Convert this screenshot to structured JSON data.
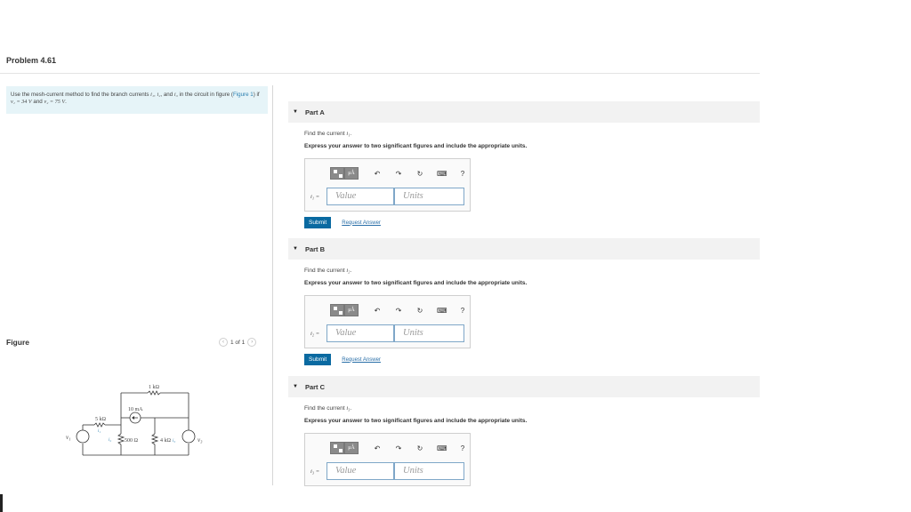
{
  "title": "Problem 4.61",
  "intro": {
    "text_a": "Use the mesh-current method to find the branch currents ",
    "i1": "i₁",
    "sep1": ", ",
    "i2": "i₂",
    "text_b": ", and ",
    "i3": "i₃",
    "text_c": " in the circuit in figure (",
    "figure_link": "Figure 1",
    "text_d": ") if ",
    "v1": "v₁ = 34 V",
    "text_e": " and ",
    "v2": "v₂ = 75 V",
    "text_f": "."
  },
  "figure": {
    "label": "Figure",
    "pager_text": "1 of 1",
    "prev_icon": "chevron-left-icon",
    "next_icon": "chevron-right-icon",
    "labels": {
      "r_top": "1 kΩ",
      "src_current": "10 mA",
      "r_left": "5 kΩ",
      "r_mid": "500 Ω",
      "r_right": "4 kΩ",
      "v1": "v₁",
      "v3": "v₃",
      "i1": "i₁",
      "i2": "i₂",
      "i3": "i₃"
    }
  },
  "parts": [
    {
      "name": "Part A",
      "find_text": "Find the current ",
      "find_var": "i₁",
      "find_end": ".",
      "express": "Express your answer to two significant figures and include the appropriate units.",
      "var_label": "i₁ =",
      "value_placeholder": "Value",
      "units_placeholder": "Units",
      "submit": "Submit",
      "request": "Request Answer"
    },
    {
      "name": "Part B",
      "find_text": "Find the current ",
      "find_var": "i₂",
      "find_end": ".",
      "express": "Express your answer to two significant figures and include the appropriate units.",
      "var_label": "i₂ =",
      "value_placeholder": "Value",
      "units_placeholder": "Units",
      "submit": "Submit",
      "request": "Request Answer"
    },
    {
      "name": "Part C",
      "find_text": "Find the current ",
      "find_var": "i₃",
      "find_end": ".",
      "express": "Express your answer to two significant figures and include the appropriate units.",
      "var_label": "i₃ =",
      "value_placeholder": "Value",
      "units_placeholder": "Units"
    }
  ],
  "toolbar": {
    "template_icon": "templates-icon",
    "mu_label": "μÅ",
    "undo_icon": "undo-icon",
    "redo_icon": "redo-icon",
    "reset_icon": "reset-icon",
    "keyboard_icon": "keyboard-icon",
    "help_label": "?"
  }
}
